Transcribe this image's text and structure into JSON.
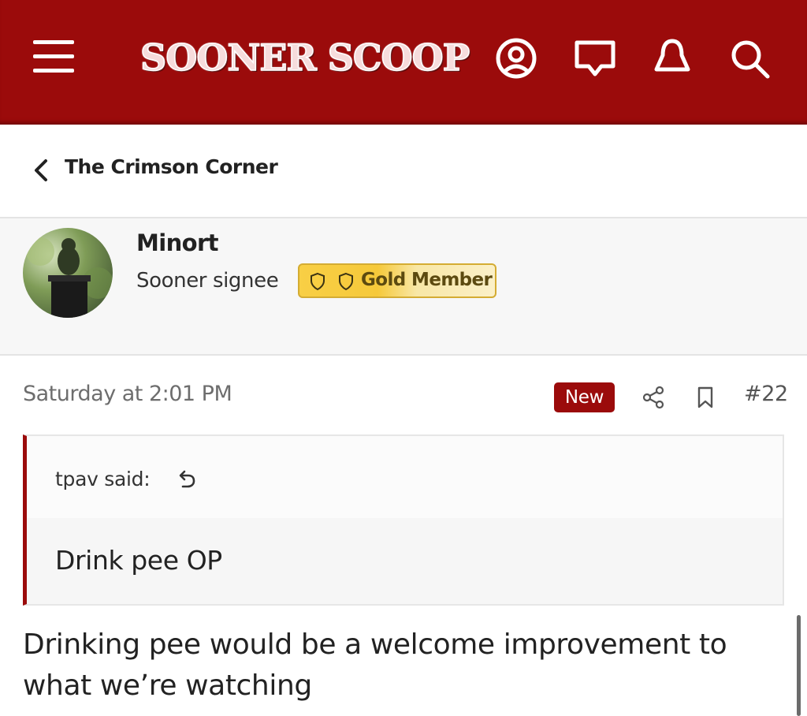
{
  "header": {
    "logo_text": "SOONER SCOOP",
    "brand_color": "#9b0b0b",
    "icons": [
      "menu-icon",
      "account-icon",
      "messages-icon",
      "alerts-icon",
      "search-icon"
    ]
  },
  "breadcrumb": {
    "label": "The Crimson Corner",
    "back_icon": "chevron-left-icon"
  },
  "author": {
    "username": "Minort",
    "title": "Sooner signee",
    "badge": "Gold Member",
    "badge_icons": [
      "shield-icon",
      "shield-icon"
    ]
  },
  "post": {
    "date": "Saturday at 2:01 PM",
    "new_label": "New",
    "number": "#22",
    "quote": {
      "author": "tpav said:",
      "text": "Drink pee OP"
    },
    "body": "Drinking pee would be a welcome improvement to what we’re watching"
  }
}
